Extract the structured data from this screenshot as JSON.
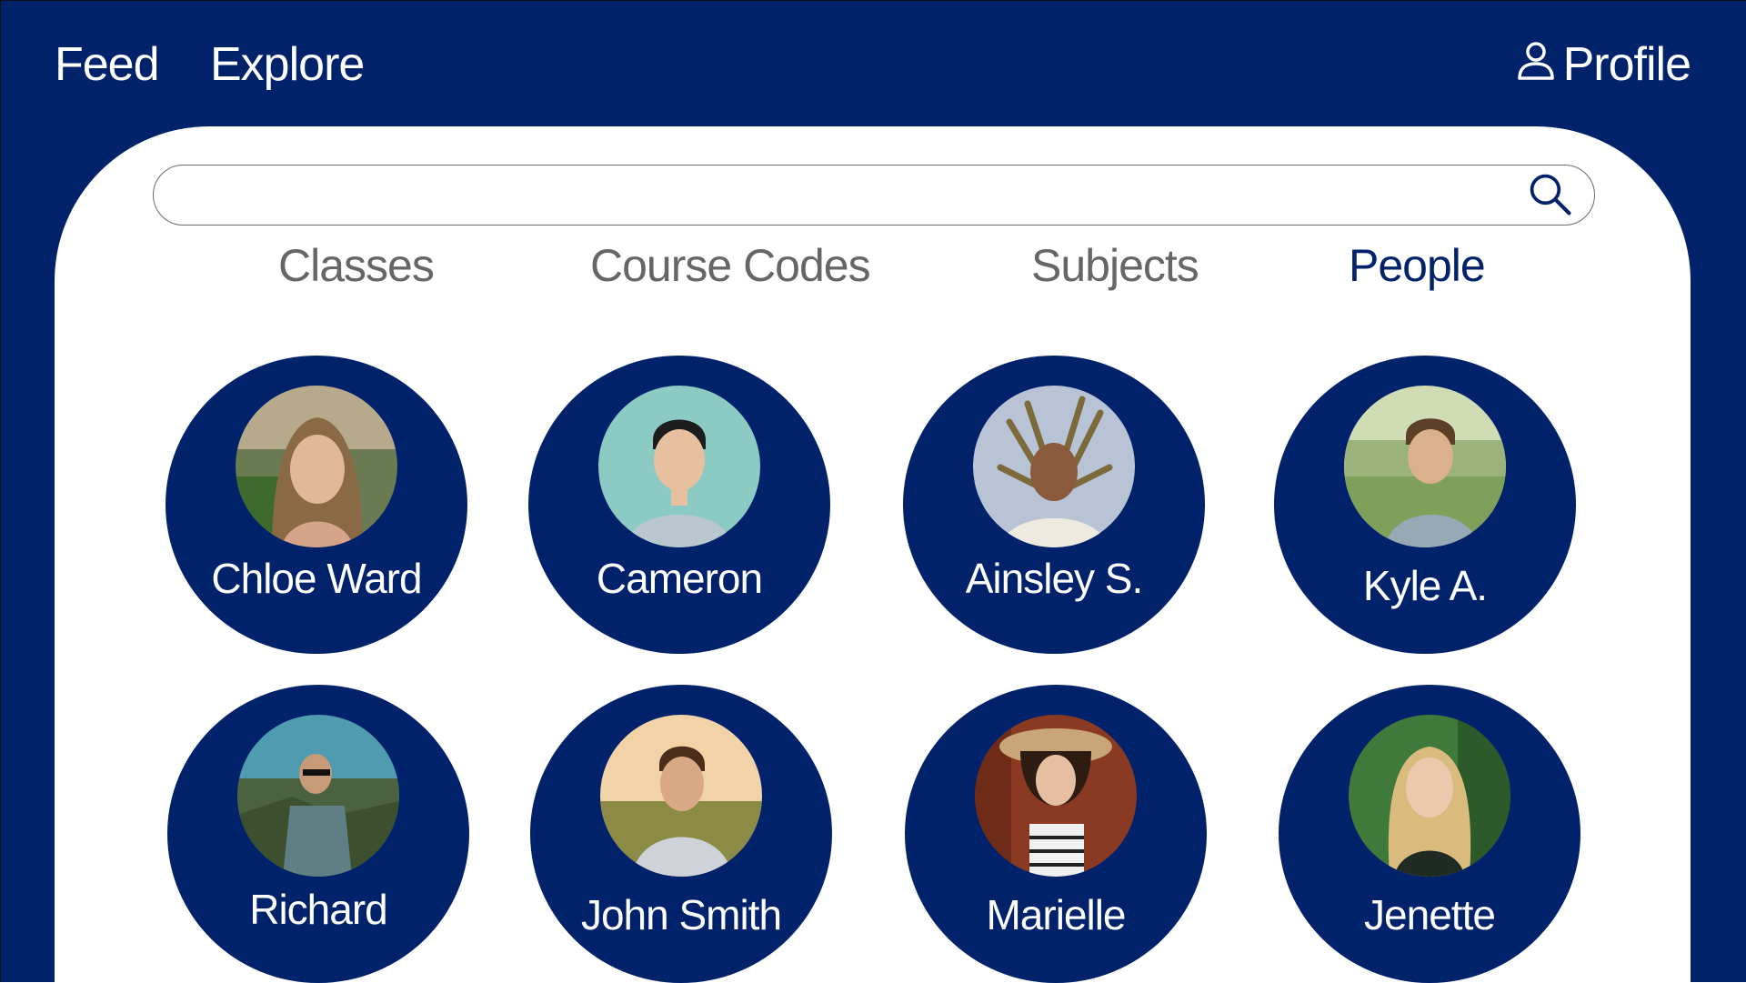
{
  "nav": {
    "feed": "Feed",
    "explore": "Explore",
    "profile": "Profile"
  },
  "search": {
    "placeholder": "",
    "value": ""
  },
  "tabs": [
    {
      "label": "Classes",
      "active": false
    },
    {
      "label": "Course Codes",
      "active": false
    },
    {
      "label": "Subjects",
      "active": false
    },
    {
      "label": "People",
      "active": true
    }
  ],
  "people": [
    {
      "name": "Chloe Ward",
      "avatar": "portrait-photo"
    },
    {
      "name": "Cameron",
      "avatar": "portrait-photo"
    },
    {
      "name": "Ainsley S.",
      "avatar": "portrait-photo"
    },
    {
      "name": "Kyle A.",
      "avatar": "portrait-photo"
    },
    {
      "name": "Richard",
      "avatar": "portrait-photo"
    },
    {
      "name": "John Smith",
      "avatar": "portrait-photo"
    },
    {
      "name": "Marielle",
      "avatar": "portrait-photo"
    },
    {
      "name": "Jenette",
      "avatar": "portrait-photo"
    }
  ],
  "colors": {
    "primary": "#00226b",
    "background": "#ffffff",
    "tab_inactive": "#666666"
  },
  "icons": {
    "profile": "user-icon",
    "search": "search-icon"
  }
}
